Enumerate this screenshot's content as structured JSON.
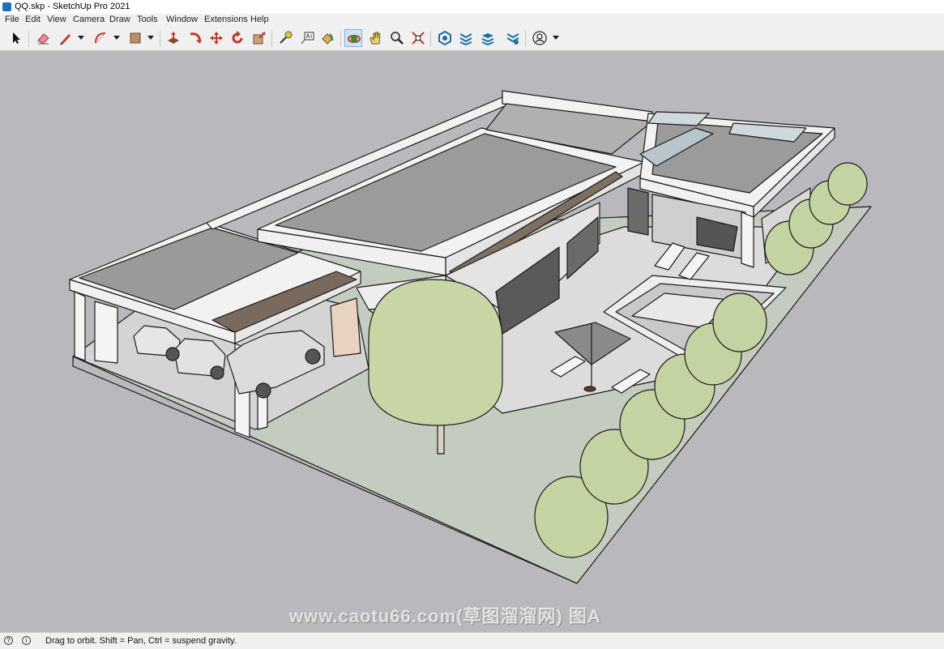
{
  "window": {
    "title": "QQ.skp - SketchUp Pro 2021"
  },
  "menu": [
    "File",
    "Edit",
    "View",
    "Camera",
    "Draw",
    "Tools",
    "Window",
    "Extensions",
    "Help"
  ],
  "toolbar": {
    "tools": [
      {
        "name": "select-tool",
        "icon": "arrow-cursor-icon",
        "active": false
      },
      {
        "name": "eraser-tool",
        "icon": "eraser-icon",
        "active": false
      },
      {
        "name": "line-tool",
        "icon": "pencil-icon",
        "active": false
      },
      {
        "name": "arc-tool",
        "icon": "arc-icon",
        "active": false
      },
      {
        "name": "shape-tool",
        "icon": "rectangle-icon",
        "active": false
      },
      {
        "name": "push-pull-tool",
        "icon": "push-pull-icon",
        "active": false
      },
      {
        "name": "follow-me-tool",
        "icon": "follow-me-icon",
        "active": false
      },
      {
        "name": "move-tool",
        "icon": "move-icon",
        "active": false
      },
      {
        "name": "rotate-tool",
        "icon": "rotate-icon",
        "active": false
      },
      {
        "name": "scale-tool",
        "icon": "scale-icon",
        "active": false
      },
      {
        "name": "tape-measure-tool",
        "icon": "tape-measure-icon",
        "active": false
      },
      {
        "name": "text-tool",
        "icon": "text-label-icon",
        "active": false
      },
      {
        "name": "paint-bucket-tool",
        "icon": "paint-bucket-icon",
        "active": false
      },
      {
        "name": "orbit-tool",
        "icon": "orbit-icon",
        "active": true
      },
      {
        "name": "pan-tool",
        "icon": "hand-icon",
        "active": false
      },
      {
        "name": "zoom-tool",
        "icon": "magnifier-icon",
        "active": false
      },
      {
        "name": "zoom-extents-tool",
        "icon": "zoom-extents-icon",
        "active": false
      },
      {
        "name": "warehouse-tool",
        "icon": "warehouse-icon",
        "active": false
      },
      {
        "name": "extension-warehouse-tool",
        "icon": "extension-warehouse-icon",
        "active": false
      },
      {
        "name": "layout-tool",
        "icon": "layers-icon",
        "active": false
      },
      {
        "name": "extension-manager-tool",
        "icon": "extension-manager-icon",
        "active": false
      },
      {
        "name": "account-tool",
        "icon": "user-account-icon",
        "active": false
      }
    ]
  },
  "colors": {
    "sky": "#b9b9bd",
    "lawn": "#c2cbbd",
    "roof": "#999999",
    "wall": "#f2f2f2",
    "tree": "#c7d6a8",
    "active_tool": "#cce4f7"
  },
  "watermark": "www.caotu66.com(草图溜溜网) 图A",
  "status": {
    "message": "Drag to orbit. Shift = Pan, Ctrl = suspend gravity."
  }
}
